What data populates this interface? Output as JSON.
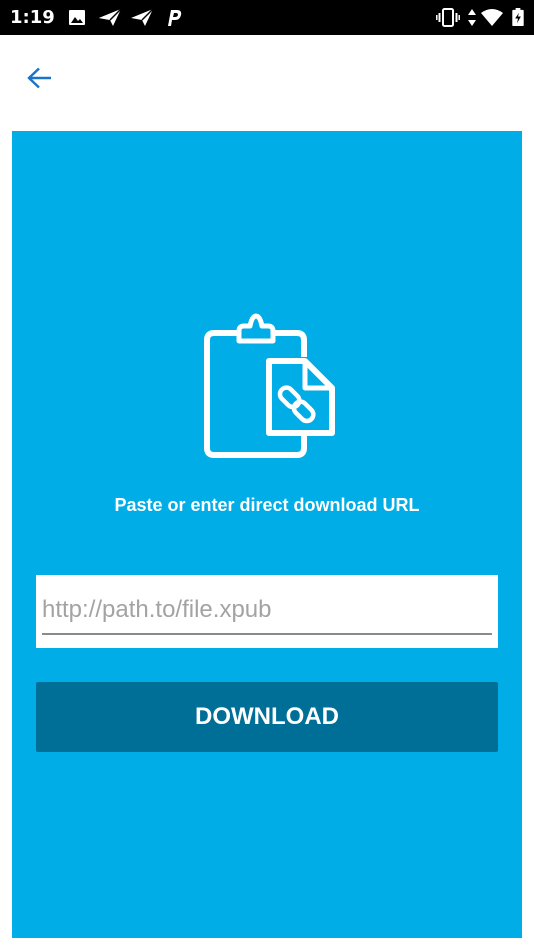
{
  "status_bar": {
    "time": "1:19",
    "left_icons": [
      "image-icon",
      "send-icon",
      "send-icon",
      "p-app-icon"
    ],
    "right_icons": [
      "vibrate-icon",
      "data-arrows-icon",
      "wifi-icon",
      "battery-icon"
    ]
  },
  "app_bar": {
    "back_icon": "arrow-left-icon"
  },
  "main": {
    "illustration_icon": "clipboard-link-icon",
    "prompt": "Paste or enter direct download URL",
    "url_value": "",
    "url_placeholder": "http://path.to/file.xpub",
    "download_label": "DOWNLOAD"
  },
  "colors": {
    "status_bar": "#000000",
    "accent": "#1a73c8",
    "panel": "#00ade6",
    "button": "#006f98",
    "text_on_panel": "#ffffff"
  }
}
